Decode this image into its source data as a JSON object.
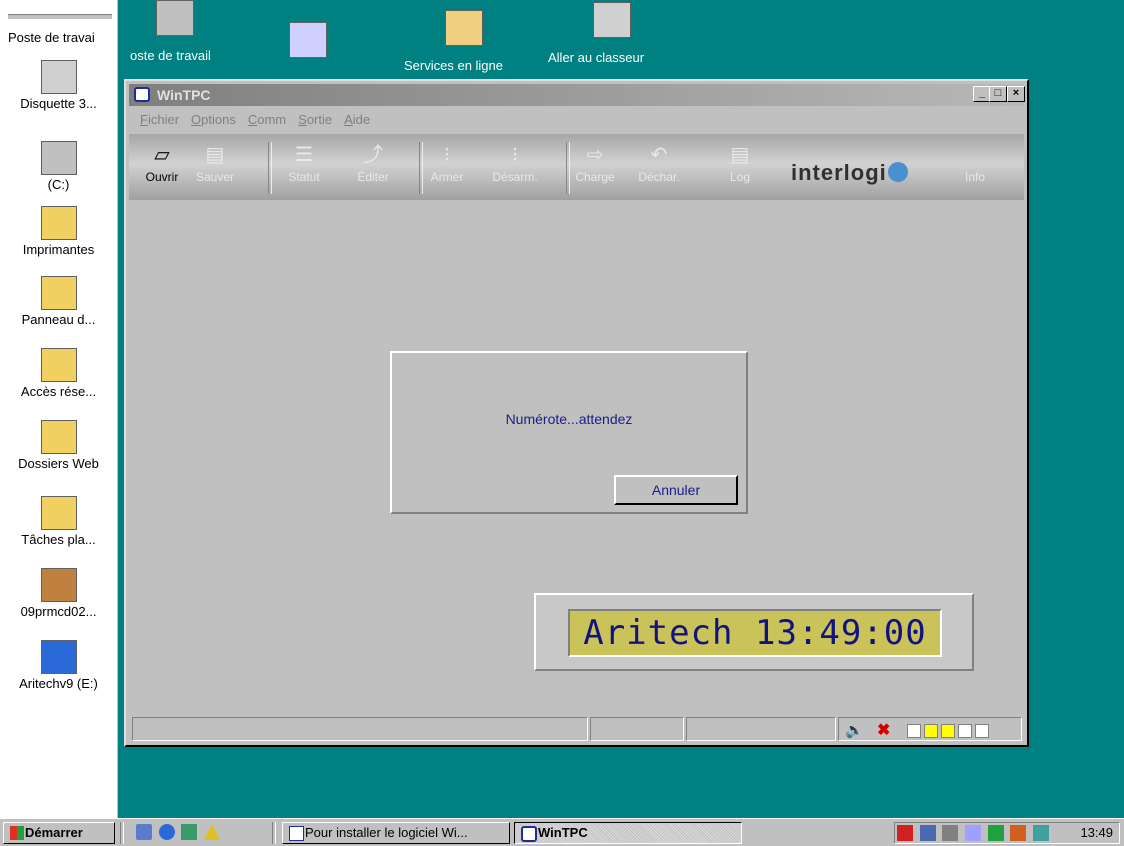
{
  "desktop": {
    "left_icons": [
      {
        "label": "Poste de travai",
        "icon": "computer-icon"
      },
      {
        "label": "Disquette 3...",
        "icon": "floppy-drive-icon"
      },
      {
        "label": "(C:)",
        "icon": "hard-drive-icon"
      },
      {
        "label": "Imprimantes",
        "icon": "printers-folder-icon"
      },
      {
        "label": "Panneau d...",
        "icon": "control-panel-folder-icon"
      },
      {
        "label": "Accès rése...",
        "icon": "dialup-folder-icon"
      },
      {
        "label": "Dossiers Web",
        "icon": "web-folders-icon"
      },
      {
        "label": "Tâches pla...",
        "icon": "scheduled-tasks-icon"
      },
      {
        "label": "09prmcd02...",
        "icon": "cd-icon"
      },
      {
        "label": "Aritechv9 (E:)",
        "icon": "aritech-drive-icon"
      }
    ],
    "top_icons": [
      {
        "label": "oste de travail",
        "icon": "computer-icon"
      },
      {
        "label": "",
        "icon": "metronome-shortcut-icon"
      },
      {
        "label": "Services en ligne",
        "icon": "folder-icon"
      },
      {
        "label": "Aller au classeur",
        "icon": "cabinet-shortcut-icon"
      }
    ]
  },
  "window": {
    "title": "WinTPC",
    "controls": [
      "_",
      "□",
      "×"
    ],
    "menu": [
      {
        "first": "F",
        "rest": "ichier"
      },
      {
        "first": "O",
        "rest": "ptions"
      },
      {
        "first": "C",
        "rest": "omm"
      },
      {
        "first": "S",
        "rest": "ortie"
      },
      {
        "first": "A",
        "rest": "ide"
      }
    ],
    "toolbar": [
      {
        "label": "Ouvrir",
        "glyph": "▱",
        "enabled": true
      },
      {
        "label": "Sauver",
        "glyph": "▤",
        "enabled": false
      },
      {
        "label": "Statut",
        "glyph": "☰",
        "enabled": false
      },
      {
        "label": "Éditer",
        "glyph": "⤴",
        "enabled": false
      },
      {
        "label": "Armer",
        "glyph": "⁝",
        "enabled": false
      },
      {
        "label": "Désarm.",
        "glyph": "⁝",
        "enabled": false
      },
      {
        "label": "Charge",
        "glyph": "⇨",
        "enabled": false
      },
      {
        "label": "Déchar.",
        "glyph": "↶",
        "enabled": false
      },
      {
        "label": "Log",
        "glyph": "▤",
        "enabled": false
      },
      {
        "label": "Info",
        "glyph": "",
        "enabled": false
      }
    ],
    "brand": "interlogi",
    "dialog": {
      "message": "Numérote...attendez",
      "cancel_label": "Annuler"
    },
    "lcd_text": "Aritech 13:49:00",
    "status_leds": [
      "#ffffff",
      "#ffff00",
      "#ffff00",
      "#ffffff",
      "#ffffff"
    ]
  },
  "taskbar": {
    "start_label": "Démarrer",
    "buttons": [
      {
        "label": "Pour installer le logiciel Wi...",
        "active": false
      },
      {
        "label": "WinTPC",
        "active": true
      }
    ],
    "clock": "13:49"
  }
}
